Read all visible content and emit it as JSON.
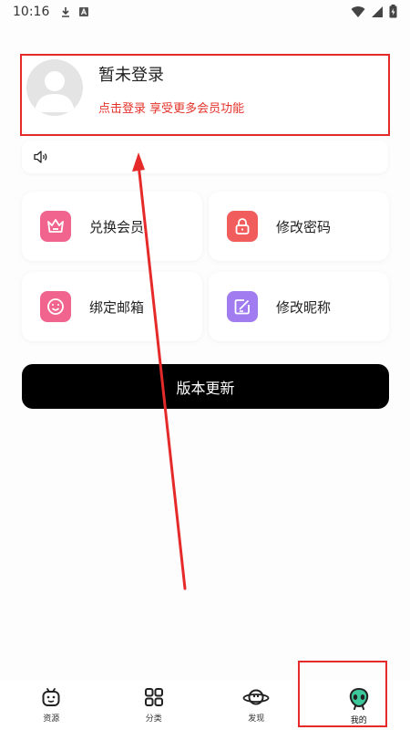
{
  "status_bar": {
    "time": "10:16"
  },
  "profile": {
    "title": "暂未登录",
    "subtitle": "点击登录 享受更多会员功能"
  },
  "tiles": [
    {
      "label": "兑换会员",
      "color": "#f0648e"
    },
    {
      "label": "修改密码",
      "color": "#f15c5c"
    },
    {
      "label": "绑定邮箱",
      "color": "#f0648e"
    },
    {
      "label": "修改昵称",
      "color": "#a07cf0"
    }
  ],
  "update_button": {
    "label": "版本更新"
  },
  "bottom_nav": [
    {
      "label": "资源",
      "icon": "robot-icon"
    },
    {
      "label": "分类",
      "icon": "grid-icon"
    },
    {
      "label": "发现",
      "icon": "planet-icon"
    },
    {
      "label": "我的",
      "icon": "alien-avatar-icon",
      "active": true
    }
  ],
  "colors": {
    "annotation_red": "#e62a2a",
    "subtitle_red": "#e5332a",
    "active_green": "#3ec79a"
  }
}
